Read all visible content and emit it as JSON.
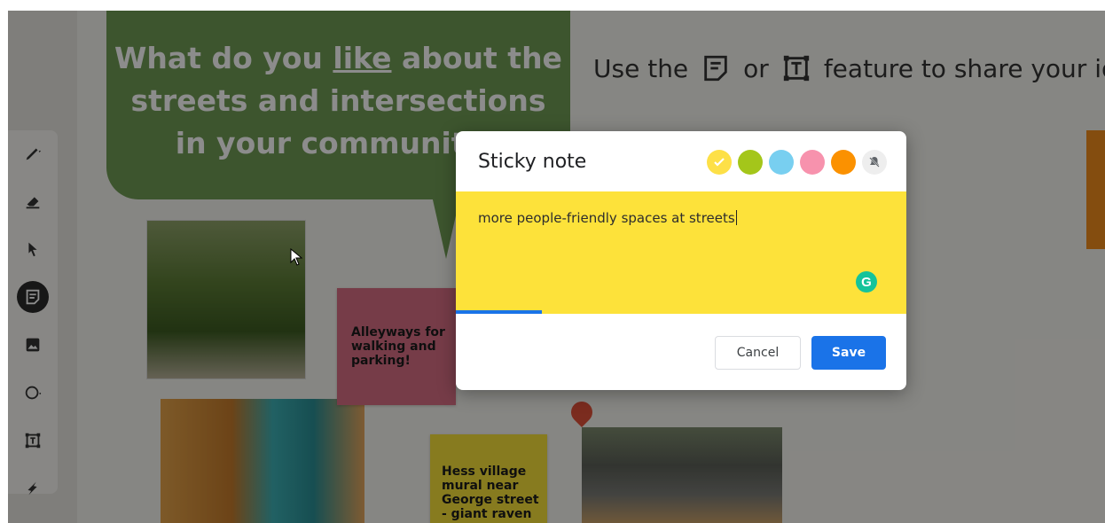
{
  "board": {
    "question": {
      "pre": "What do you ",
      "emph": "like",
      "post": " about the",
      "line2": "streets and intersections",
      "line3": "in your community?"
    },
    "instruction": {
      "pre": "Use the",
      "mid": "or",
      "post": "feature to share your ideas"
    },
    "sticky_alleyways": "Alleyways for walking and parking!",
    "sticky_hess": "Hess village mural near George street - giant raven"
  },
  "toolbar": {
    "tools": [
      {
        "name": "pen-tool",
        "icon": "pen-icon"
      },
      {
        "name": "eraser-tool",
        "icon": "eraser-icon"
      },
      {
        "name": "select-tool",
        "icon": "pointer-icon"
      },
      {
        "name": "sticky-note-tool",
        "icon": "sticky-note-icon",
        "active": true
      },
      {
        "name": "image-tool",
        "icon": "image-icon"
      },
      {
        "name": "shape-tool",
        "icon": "circle-icon"
      },
      {
        "name": "text-box-tool",
        "icon": "text-box-icon"
      },
      {
        "name": "laser-tool",
        "icon": "laser-icon"
      }
    ]
  },
  "dialog": {
    "title": "Sticky note",
    "text_value": "more people-friendly spaces at streets",
    "cancel_label": "Cancel",
    "save_label": "Save",
    "colors": [
      {
        "name": "yellow",
        "hex": "#fde047",
        "selected": true
      },
      {
        "name": "green",
        "hex": "#a4c61a"
      },
      {
        "name": "blue",
        "hex": "#78cff0"
      },
      {
        "name": "pink",
        "hex": "#f792ad"
      },
      {
        "name": "orange",
        "hex": "#fb9100"
      }
    ],
    "note_bg": "#fde23a",
    "accent": "#1a73e8",
    "upload_progress": 0.19
  }
}
